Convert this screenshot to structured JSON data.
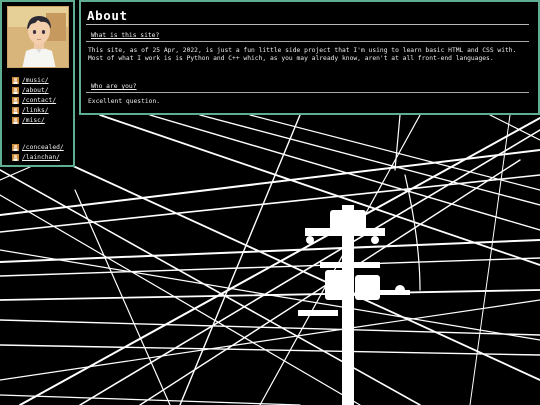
{
  "page": {
    "title": "About"
  },
  "sidebar": {
    "avatar": "character-portrait",
    "items": [
      {
        "label": "/music/",
        "icon": "portrait-icon"
      },
      {
        "label": "/about/",
        "icon": "portrait-icon"
      },
      {
        "label": "/contact/",
        "icon": "portrait-icon"
      },
      {
        "label": "/links/",
        "icon": "portrait-icon"
      },
      {
        "label": "/misc/",
        "icon": "portrait-icon"
      }
    ],
    "extra_items": [
      {
        "label": "/concealed/",
        "icon": "portrait-icon"
      },
      {
        "label": "/lainchan/",
        "icon": "portrait-icon"
      }
    ]
  },
  "sections": [
    {
      "heading": "What is this site?",
      "body_line_1": "This site, as of 25 Apr, 2022, is just a fun little side project that I'm using to learn basic HTML and CSS with.",
      "body_line_2": "Most of what I work is is Python and C++ which, as you may already know, aren't at all front-end languages."
    },
    {
      "heading": "Who are you?",
      "body_line_1": "Excellent question."
    }
  ],
  "colors": {
    "border": "#5fae92",
    "background": "#000000",
    "text": "#f0f0f0"
  }
}
